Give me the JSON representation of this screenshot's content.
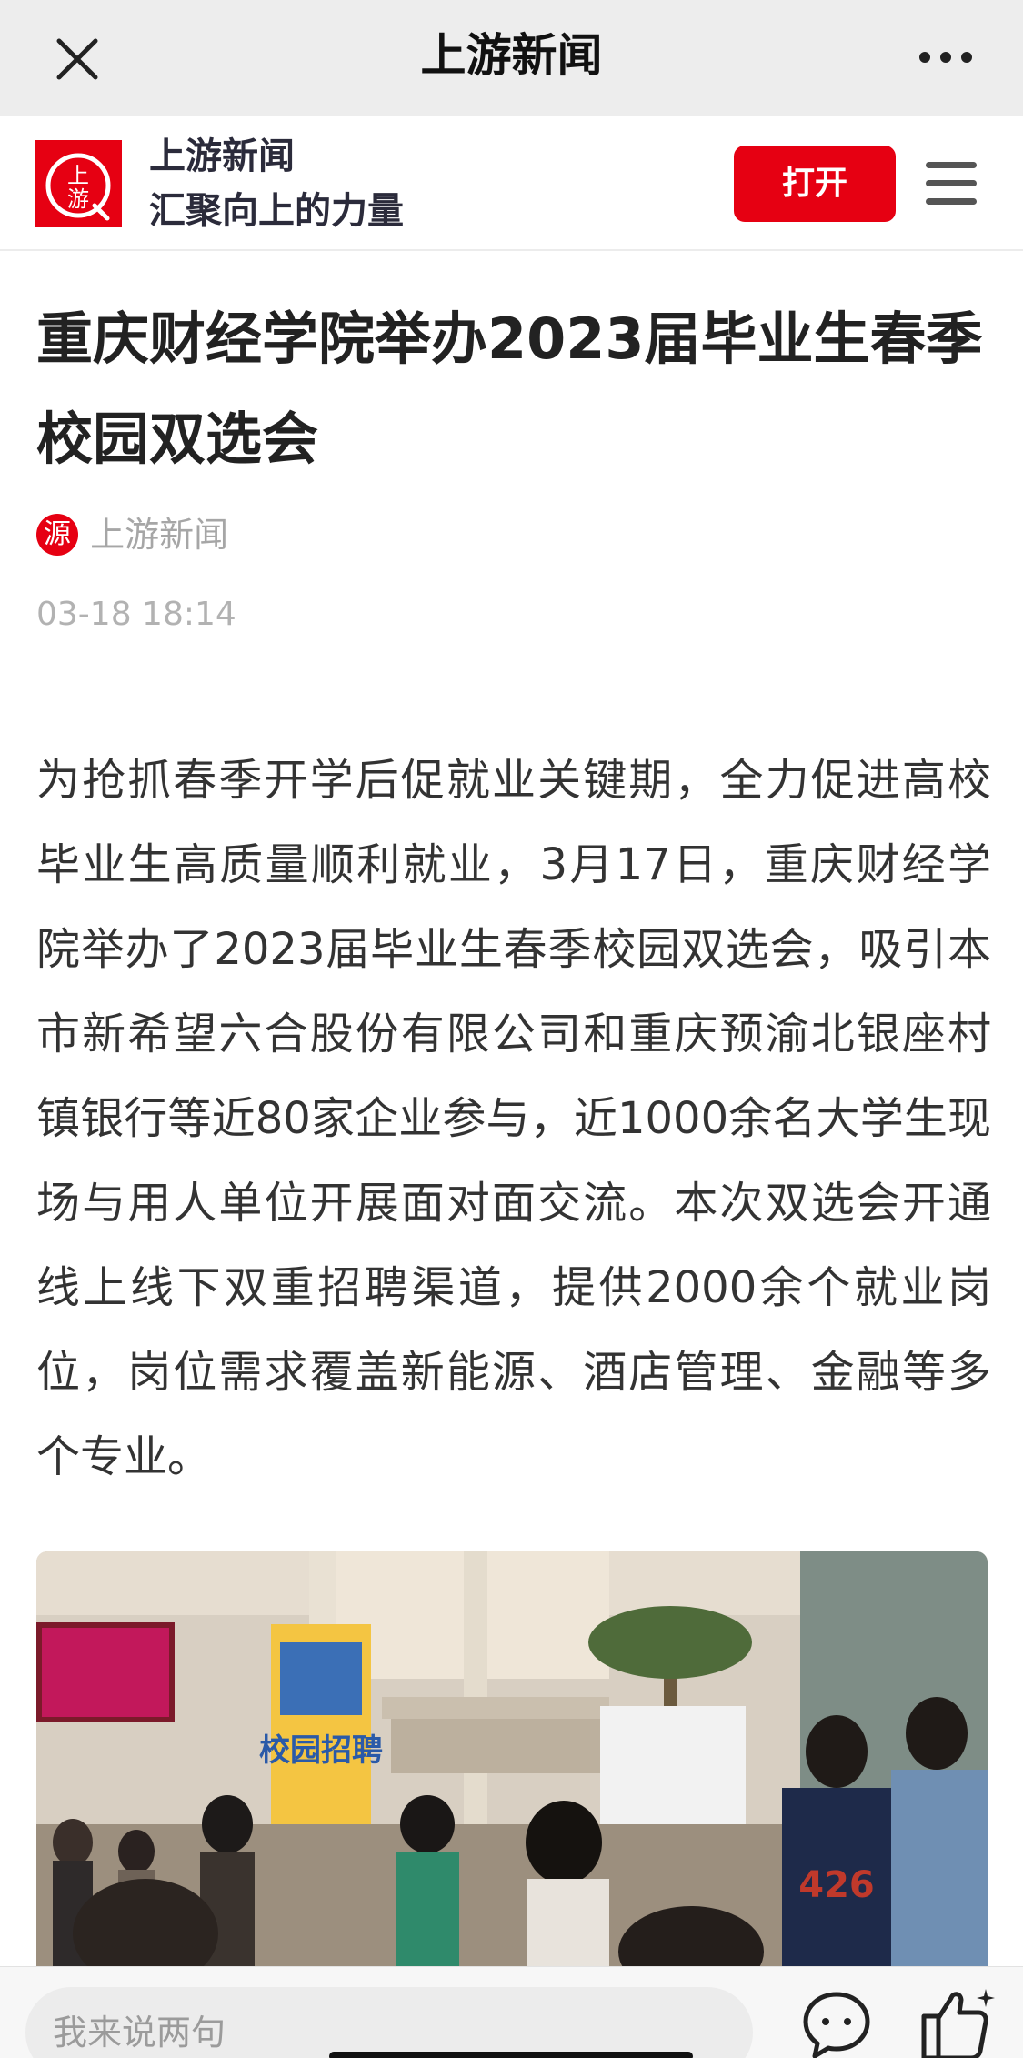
{
  "topbar": {
    "title": "上游新闻",
    "close_icon": "close-icon",
    "more_icon": "more-dots-icon"
  },
  "banner": {
    "logo_text": "上游",
    "name": "上游新闻",
    "slogan": "汇聚向上的力量",
    "open_label": "打开",
    "menu_icon": "hamburger-menu-icon",
    "brand_color": "#e60012"
  },
  "article": {
    "headline": "重庆财经学院举办2023届毕业生春季校园双选会",
    "source_badge": "源",
    "source_name": "上游新闻",
    "timestamp": "03-18 18:14",
    "body": "为抢抓春季开学后促就业关键期，全力促进高校毕业生高质量顺利就业，3月17日，重庆财经学院举办了2023届毕业生春季校园双选会，吸引本市新希望六合股份有限公司和重庆预渝北银座村镇银行等近80家企业参与，近1000余名大学生现场与用人单位开展面对面交流。本次双选会开通线上线下双重招聘渠道，提供2000余个就业岗位，岗位需求覆盖新能源、酒店管理、金融等多个专业。",
    "photo": {
      "poster_text": "校园招聘",
      "shirt_text": "426"
    }
  },
  "bottombar": {
    "comment_placeholder": "我来说两句",
    "comment_icon": "comment-bubble-icon",
    "like_icon": "thumbs-up-icon"
  }
}
